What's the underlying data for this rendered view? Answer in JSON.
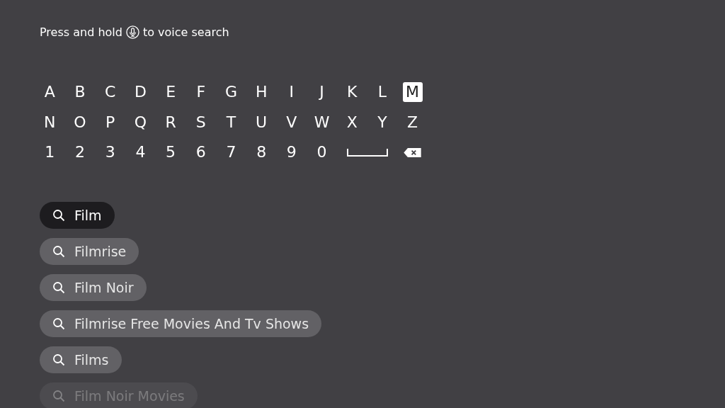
{
  "voice_hint": {
    "before": "Press and hold",
    "after": "to voice search"
  },
  "keyboard": {
    "rows": [
      [
        {
          "kind": "char",
          "label": "A",
          "selected": false
        },
        {
          "kind": "char",
          "label": "B",
          "selected": false
        },
        {
          "kind": "char",
          "label": "C",
          "selected": false
        },
        {
          "kind": "char",
          "label": "D",
          "selected": false
        },
        {
          "kind": "char",
          "label": "E",
          "selected": false
        },
        {
          "kind": "char",
          "label": "F",
          "selected": false
        },
        {
          "kind": "char",
          "label": "G",
          "selected": false
        },
        {
          "kind": "char",
          "label": "H",
          "selected": false
        },
        {
          "kind": "char",
          "label": "I",
          "selected": false
        },
        {
          "kind": "char",
          "label": "J",
          "selected": false
        },
        {
          "kind": "char",
          "label": "K",
          "selected": false
        },
        {
          "kind": "char",
          "label": "L",
          "selected": false
        },
        {
          "kind": "char",
          "label": "M",
          "selected": true
        }
      ],
      [
        {
          "kind": "char",
          "label": "N",
          "selected": false
        },
        {
          "kind": "char",
          "label": "O",
          "selected": false
        },
        {
          "kind": "char",
          "label": "P",
          "selected": false
        },
        {
          "kind": "char",
          "label": "Q",
          "selected": false
        },
        {
          "kind": "char",
          "label": "R",
          "selected": false
        },
        {
          "kind": "char",
          "label": "S",
          "selected": false
        },
        {
          "kind": "char",
          "label": "T",
          "selected": false
        },
        {
          "kind": "char",
          "label": "U",
          "selected": false
        },
        {
          "kind": "char",
          "label": "V",
          "selected": false
        },
        {
          "kind": "char",
          "label": "W",
          "selected": false
        },
        {
          "kind": "char",
          "label": "X",
          "selected": false
        },
        {
          "kind": "char",
          "label": "Y",
          "selected": false
        },
        {
          "kind": "char",
          "label": "Z",
          "selected": false
        }
      ],
      [
        {
          "kind": "char",
          "label": "1",
          "selected": false
        },
        {
          "kind": "char",
          "label": "2",
          "selected": false
        },
        {
          "kind": "char",
          "label": "3",
          "selected": false
        },
        {
          "kind": "char",
          "label": "4",
          "selected": false
        },
        {
          "kind": "char",
          "label": "5",
          "selected": false
        },
        {
          "kind": "char",
          "label": "6",
          "selected": false
        },
        {
          "kind": "char",
          "label": "7",
          "selected": false
        },
        {
          "kind": "char",
          "label": "8",
          "selected": false
        },
        {
          "kind": "char",
          "label": "9",
          "selected": false
        },
        {
          "kind": "char",
          "label": "0",
          "selected": false
        },
        {
          "kind": "space",
          "selected": false
        },
        {
          "kind": "backspace",
          "selected": false
        }
      ]
    ]
  },
  "suggestions": [
    {
      "label": "Film",
      "selected": true,
      "faded": false
    },
    {
      "label": "Filmrise",
      "selected": false,
      "faded": false
    },
    {
      "label": "Film Noir",
      "selected": false,
      "faded": false
    },
    {
      "label": "Filmrise Free Movies And Tv Shows",
      "selected": false,
      "faded": false
    },
    {
      "label": "Films",
      "selected": false,
      "faded": false
    },
    {
      "label": "Film Noir Movies",
      "selected": false,
      "faded": true
    }
  ]
}
